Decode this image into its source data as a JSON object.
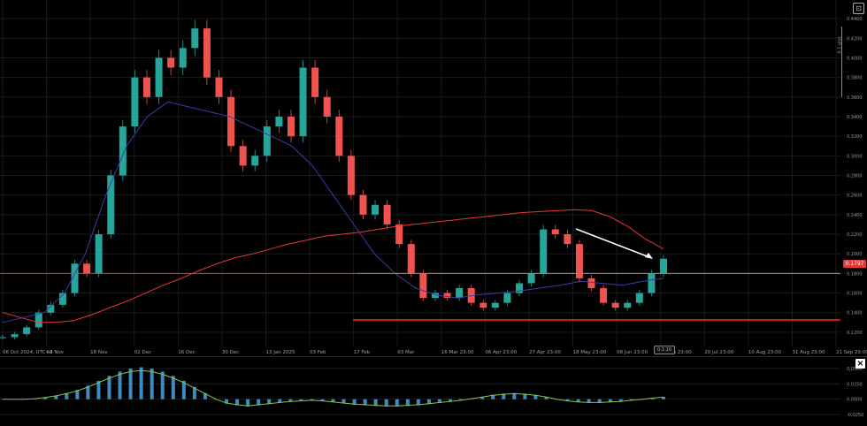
{
  "chart_data": [
    {
      "type": "candlestick",
      "symbol_timezone": "06 Oct 2024, UTC+2",
      "x_tick_labels": [
        "06 Oct 2024, UTC+2",
        "04 Nov",
        "18 Nov",
        "02 Dec",
        "16 Dec",
        "30 Dec",
        "13 Jan 2025",
        "03 Feb",
        "17 Feb",
        "03 Mar",
        "16 Mar 23:00",
        "06 Apr 23:00",
        "27 Apr 23:00",
        "18 May 23:00",
        "08 Jun 23:00",
        "29 Jun 23:00",
        "20 Jul 23:00",
        "10 Aug 23:00",
        "31 Aug 23:00",
        "21 Sep 23:00"
      ],
      "y_tick_labels": [
        "0.4400",
        "0.4200",
        "0.4000",
        "0.3800",
        "0.3600",
        "0.3400",
        "0.3200",
        "0.3000",
        "0.2800",
        "0.2600",
        "0.2400",
        "0.2200",
        "0.2000",
        "0.1800",
        "0.1600",
        "0.1400",
        "0.1200"
      ],
      "ylim": [
        0.11,
        0.45
      ],
      "grid": true,
      "current_price": "0.1797",
      "horizontal_levels": [
        0.18,
        0.1325
      ],
      "series": [
        {
          "kind": "ohlc",
          "values": [
            0.115,
            0.118,
            0.125,
            0.14,
            0.148,
            0.16,
            0.19,
            0.18,
            0.22,
            0.28,
            0.33,
            0.38,
            0.36,
            0.4,
            0.39,
            0.41,
            0.43,
            0.38,
            0.36,
            0.31,
            0.29,
            0.3,
            0.33,
            0.34,
            0.32,
            0.39,
            0.36,
            0.34,
            0.3,
            0.26,
            0.24,
            0.25,
            0.23,
            0.21,
            0.18,
            0.155,
            0.16,
            0.155,
            0.165,
            0.15,
            0.145,
            0.15,
            0.16,
            0.17,
            0.18,
            0.225,
            0.22,
            0.21,
            0.175,
            0.165,
            0.15,
            0.145,
            0.15,
            0.16,
            0.18,
            0.195
          ]
        },
        {
          "kind": "ma-red",
          "values": [
            0.14,
            0.135,
            0.13,
            0.13,
            0.132,
            0.138,
            0.145,
            0.152,
            0.16,
            0.168,
            0.175,
            0.183,
            0.19,
            0.196,
            0.2,
            0.205,
            0.21,
            0.214,
            0.218,
            0.22,
            0.222,
            0.225,
            0.228,
            0.23,
            0.232,
            0.234,
            0.236,
            0.238,
            0.24,
            0.242,
            0.243,
            0.244,
            0.245,
            0.244,
            0.238,
            0.228,
            0.215,
            0.205
          ]
        },
        {
          "kind": "ma-purple",
          "values": [
            0.13,
            0.135,
            0.14,
            0.16,
            0.2,
            0.26,
            0.31,
            0.34,
            0.355,
            0.35,
            0.345,
            0.34,
            0.33,
            0.32,
            0.31,
            0.29,
            0.26,
            0.23,
            0.2,
            0.18,
            0.165,
            0.158,
            0.155,
            0.158,
            0.16,
            0.162,
            0.165,
            0.168,
            0.172,
            0.17,
            0.168,
            0.172,
            0.175
          ]
        }
      ]
    },
    {
      "type": "histogram",
      "y_tick_labels": [
        "0.0500",
        "0.0250",
        "0.0000",
        "-0.0250"
      ],
      "ylim": [
        -0.035,
        0.06
      ],
      "values": [
        0,
        0,
        0,
        0.001,
        0.003,
        0.006,
        0.01,
        0.015,
        0.022,
        0.03,
        0.038,
        0.045,
        0.05,
        0.052,
        0.05,
        0.045,
        0.038,
        0.03,
        0.02,
        0.01,
        0.0,
        -0.007,
        -0.01,
        -0.012,
        -0.01,
        -0.008,
        -0.006,
        -0.004,
        -0.003,
        -0.002,
        -0.003,
        -0.005,
        -0.007,
        -0.009,
        -0.01,
        -0.011,
        -0.012,
        -0.012,
        -0.011,
        -0.01,
        -0.008,
        -0.006,
        -0.004,
        -0.002,
        0.001,
        0.004,
        0.007,
        0.009,
        0.01,
        0.009,
        0.007,
        0.004,
        0.0,
        -0.003,
        -0.005,
        -0.006,
        -0.006,
        -0.005,
        -0.004,
        -0.002,
        0.0,
        0.002,
        0.004
      ]
    }
  ],
  "ui": {
    "price_tag": "0.1797",
    "scale_label": "0.1 plot",
    "time_badge": "0.1 20",
    "close_label": "×",
    "tool_label": "⊡"
  },
  "colors": {
    "up": "#26a69a",
    "down": "#ef5350",
    "ma_red": "#e53935",
    "ma_purple": "#3f3aa8",
    "level_green": "#6aa84f",
    "level_red": "#ff2a1a",
    "hist": "#4aa3df",
    "signal": "#8bc34a"
  }
}
